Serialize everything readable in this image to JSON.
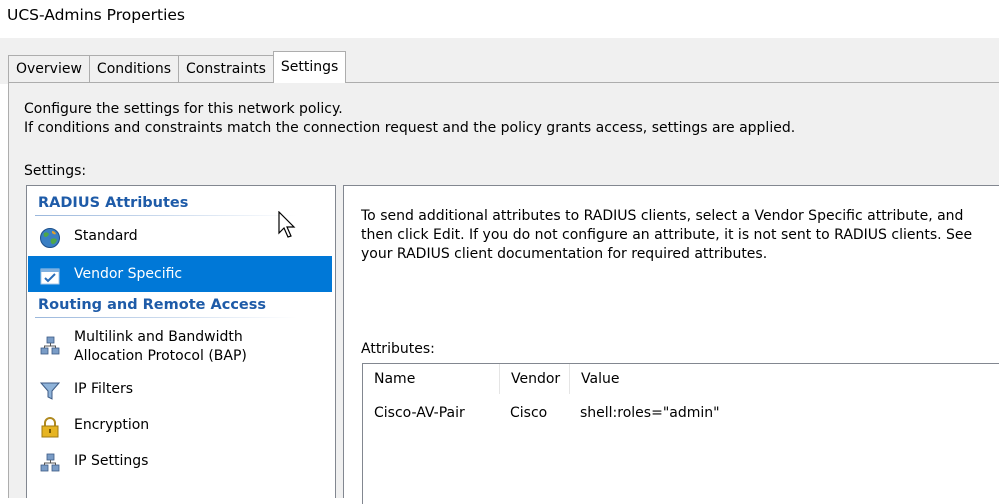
{
  "window": {
    "title": "UCS-Admins Properties"
  },
  "tabs": [
    {
      "label": "Overview"
    },
    {
      "label": "Conditions"
    },
    {
      "label": "Constraints"
    },
    {
      "label": "Settings",
      "active": true
    }
  ],
  "description": {
    "line1": "Configure the settings for this network policy.",
    "line2": "If conditions and constraints match the connection request and the policy grants access, settings are applied."
  },
  "settings_label": "Settings:",
  "tree": {
    "radius_section": "RADIUS Attributes",
    "standard": "Standard",
    "vendor_specific": "Vendor Specific",
    "routing_section": "Routing and Remote Access",
    "multilink_line1": "Multilink and Bandwidth",
    "multilink_line2": "Allocation Protocol (BAP)",
    "ip_filters": "IP Filters",
    "encryption": "Encryption",
    "ip_settings": "IP Settings"
  },
  "detail": {
    "text": "To send additional attributes to RADIUS clients, select a Vendor Specific attribute, and then click Edit. If you do not configure an attribute, it is not sent to RADIUS clients. See your RADIUS client documentation for required attributes.",
    "attributes_label": "Attributes:",
    "columns": [
      "Name",
      "Vendor",
      "Value"
    ],
    "rows": [
      {
        "name": "Cisco-AV-Pair",
        "vendor": "Cisco",
        "value": "shell:roles=\"admin\""
      }
    ]
  },
  "colors": {
    "selection": "#0078d7",
    "section_heading": "#1e5ba8"
  }
}
